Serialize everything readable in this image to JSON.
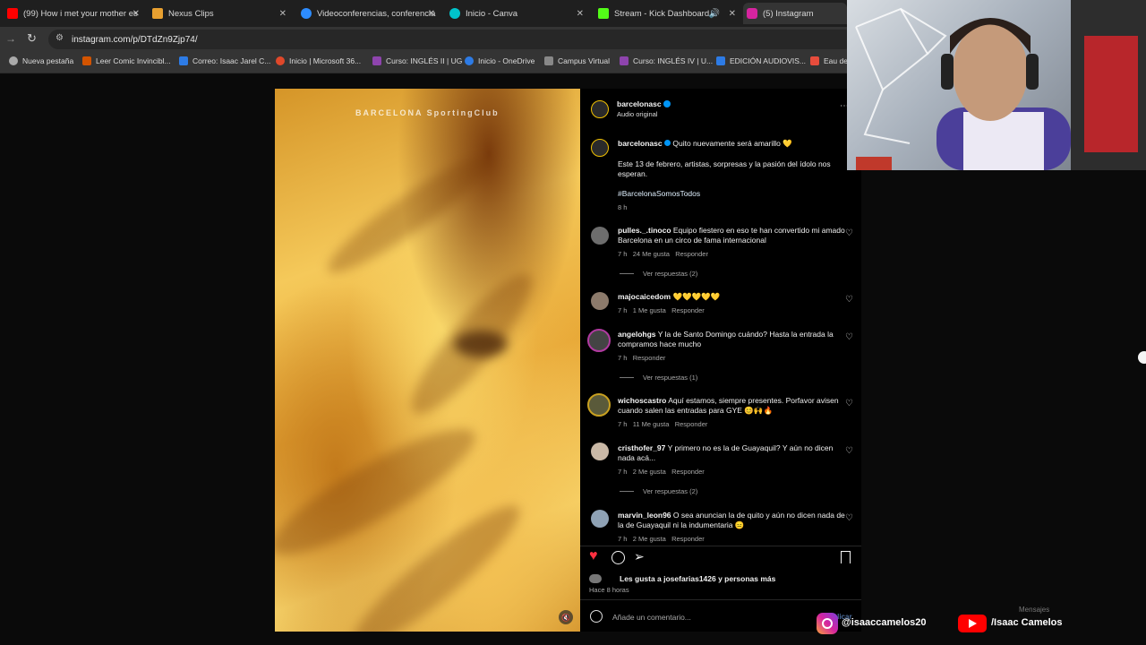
{
  "tabs": [
    {
      "title": "(99) How i met your mother es",
      "color": "#ff0000"
    },
    {
      "title": "Nexus Clips",
      "color": "#e8a030"
    },
    {
      "title": "Videoconferencias, conferencia",
      "color": "#2d8cff"
    },
    {
      "title": "Inicio - Canva",
      "color": "#00c4cc"
    },
    {
      "title": "Stream - Kick Dashboard",
      "color": "#53fc18"
    },
    {
      "title": "(5) Instagram",
      "color": "#d6249f"
    }
  ],
  "address": {
    "url": "instagram.com/p/DTdZn9Zjp74/"
  },
  "bookmarks": [
    {
      "label": "Nueva pestaña",
      "color": "#aaaaaa"
    },
    {
      "label": "Leer Comic Invincibl...",
      "color": "#d35400"
    },
    {
      "label": "Correo: Isaac Jarel C...",
      "color": "#2d7be5"
    },
    {
      "label": "Inicio | Microsoft 36...",
      "color": "#e0482a"
    },
    {
      "label": "Curso: INGLÉS II | UG",
      "color": "#8e44ad"
    },
    {
      "label": "Inicio - OneDrive",
      "color": "#2d7be5"
    },
    {
      "label": "Campus Virtual",
      "color": "#888888"
    },
    {
      "label": "Curso: INGLÉS IV | U...",
      "color": "#8e44ad"
    },
    {
      "label": "EDICIÓN AUDIOVIS...",
      "color": "#2d7be5"
    },
    {
      "label": "Eau de",
      "color": "#e74c3c"
    }
  ],
  "video": {
    "watermark": "BARCELONA SportingClub"
  },
  "post": {
    "author": "barcelonasc",
    "audio": "Audio original",
    "caption_line1": "Quito nuevamente será amarillo 💛",
    "caption_line2": "Este 13 de febrero, artistas, sorpresas y la pasión del ídolo nos esperan.",
    "hashtag": "#BarcelonaSomosTodos",
    "time": "8 h"
  },
  "comments": [
    {
      "user": "pulles._.tinoco",
      "text": "Equipo fiestero en eso te han convertido mi amado Barcelona en un circo de fama internacional",
      "time": "7 h",
      "likes": "24 Me gusta",
      "reply": "Responder",
      "replies": "Ver respuestas (2)"
    },
    {
      "user": "majocaicedom",
      "text": "💛💛💛💛💛",
      "time": "7 h",
      "likes": "1 Me gusta",
      "reply": "Responder",
      "replies": ""
    },
    {
      "user": "angelohgs",
      "text": "Y la de Santo Domingo cuándo? Hasta la entrada la compramos hace mucho",
      "time": "7 h",
      "likes": "",
      "reply": "Responder",
      "replies": "Ver respuestas (1)"
    },
    {
      "user": "wichoscastro",
      "text": "Aquí estamos, siempre presentes. Porfavor avisen cuando salen las entradas para GYE 😊🙌🔥",
      "time": "7 h",
      "likes": "11 Me gusta",
      "reply": "Responder",
      "replies": ""
    },
    {
      "user": "cristhofer_97",
      "text": "Y primero no es la de Guayaquil? Y aún no dicen nada acá...",
      "time": "7 h",
      "likes": "2 Me gusta",
      "reply": "Responder",
      "replies": "Ver respuestas (2)"
    },
    {
      "user": "marvin_leon96",
      "text": "O sea anuncian la de quito y aún no dicen nada de la de Guayaquil ni la indumentaria 😑",
      "time": "7 h",
      "likes": "2 Me gusta",
      "reply": "Responder",
      "replies": ""
    }
  ],
  "actions": {
    "likes_text": "Les gusta a josefarias1426 y personas más",
    "posted": "Hace 8 horas",
    "comment_placeholder": "Añade un comentario...",
    "publish": "Publicar"
  },
  "overlay": {
    "instagram_handle": "@isaaccamelos20",
    "youtube_handle": "/Isaac Camelos",
    "messages": "Mensajes"
  },
  "colors": {
    "accent": "#0095f6",
    "like": "#ff3040"
  }
}
